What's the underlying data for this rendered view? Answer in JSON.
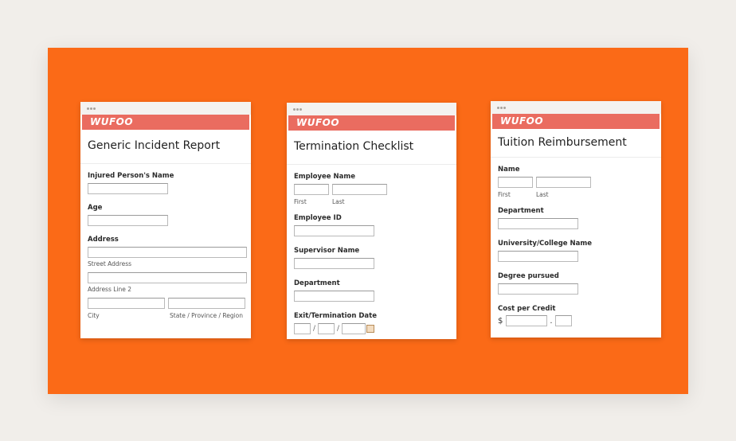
{
  "logo_text": "WUFOO",
  "cards": [
    {
      "title": "Generic Incident Report",
      "fields": {
        "injured_name": "Injured Person's Name",
        "age": "Age",
        "address": "Address",
        "street_address": "Street Address",
        "address_line2": "Address Line 2",
        "city": "City",
        "state": "State / Province / Region"
      }
    },
    {
      "title": "Termination Checklist",
      "fields": {
        "employee_name": "Employee Name",
        "first": "First",
        "last": "Last",
        "employee_id": "Employee ID",
        "supervisor_name": "Supervisor Name",
        "department": "Department",
        "exit_date": "Exit/Termination Date",
        "date_sep": "/"
      }
    },
    {
      "title": "Tuition Reimbursement",
      "fields": {
        "name": "Name",
        "first": "First",
        "last": "Last",
        "department": "Department",
        "university": "University/College Name",
        "degree": "Degree pursued",
        "cost": "Cost per Credit",
        "currency": "$",
        "decimal": "."
      }
    }
  ],
  "colors": {
    "background": "#f1eeea",
    "stage": "#fb6a17",
    "brandbar": "#ea6c60"
  }
}
